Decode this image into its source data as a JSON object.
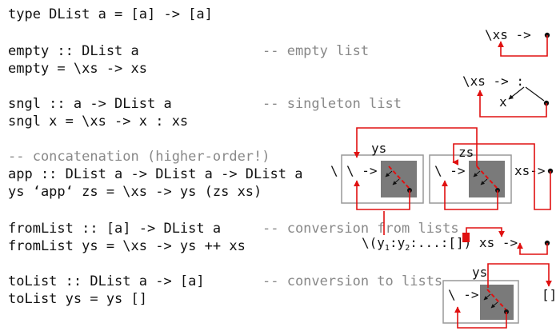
{
  "code_lines": [
    {
      "id": "type-line",
      "text": "type DList a = [a] -> [a]"
    },
    {
      "id": "empty-sig",
      "text": "empty :: DList a"
    },
    {
      "id": "empty-def",
      "text": "empty = \\xs -> xs"
    },
    {
      "id": "sngl-sig",
      "text": "sngl :: a -> DList a"
    },
    {
      "id": "sngl-def",
      "text": "sngl x = \\xs -> x : xs"
    },
    {
      "id": "concat-comment",
      "text": "-- concatenation (higher-order!)"
    },
    {
      "id": "app-sig",
      "text": "app :: DList a -> DList a -> DList a"
    },
    {
      "id": "app-def",
      "text": "ys ‘app‘ zs = \\xs -> ys (zs xs)"
    },
    {
      "id": "fromlist-sig",
      "text": "fromList :: [a] -> DList a"
    },
    {
      "id": "fromlist-def",
      "text": "fromList ys = \\xs -> ys ++ xs"
    },
    {
      "id": "tolist-sig",
      "text": "toList :: DList a -> [a]"
    },
    {
      "id": "tolist-def",
      "text": "toList ys = ys []"
    }
  ],
  "comments": {
    "empty": "-- empty list",
    "sngl": "-- singleton list",
    "fromlist": "-- conversion from lists",
    "tolist": "-- conversion to lists"
  },
  "diagrams": {
    "empty_lambda": "\\xs ->",
    "sngl_lambda": "\\xs -> :",
    "sngl_x": "x",
    "app_ys_label": "ys",
    "app_zs_label": "zs",
    "app_backslash": "\\",
    "app_arrow1": "\\ ->",
    "app_arrow2": "\\ ->",
    "app_xs_arrow": "xs->",
    "fromlist_open": "\\(y",
    "fromlist_sub1": "1",
    "fromlist_colon1": ":y",
    "fromlist_sub2": "2",
    "fromlist_rest": ":...:[]) xs ->",
    "tolist_ys_label": "ys",
    "tolist_arrow": "\\ ->",
    "tolist_nil": "[]"
  },
  "colors": {
    "text": "#111111",
    "comment": "#888888",
    "wire": "#e01010",
    "box_fill": "#7a7a7a",
    "box_border": "#999999"
  }
}
